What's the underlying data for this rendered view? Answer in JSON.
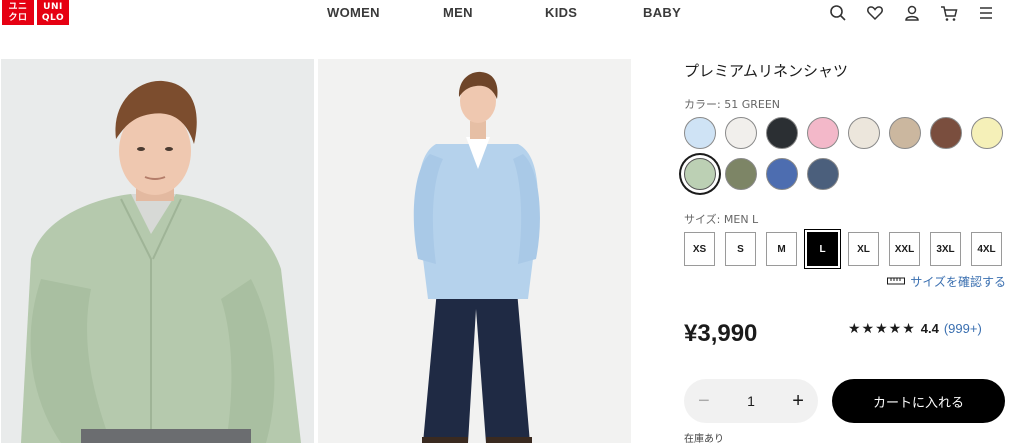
{
  "header": {
    "logo": {
      "top_text": "ユニ",
      "bottom_text": "クロ",
      "top_text2": "UNI",
      "bottom_text2": "QLO",
      "color": "#e60012"
    },
    "nav": [
      "WOMEN",
      "MEN",
      "KIDS",
      "BABY"
    ],
    "icons": [
      "search-icon",
      "heart-icon",
      "user-icon",
      "cart-icon",
      "menu-icon"
    ]
  },
  "product": {
    "title": "プレミアムリネンシャツ",
    "color_label": "カラー: 51 GREEN",
    "swatches": [
      {
        "name": "light-blue",
        "color": "#cfe3f5"
      },
      {
        "name": "off-white",
        "color": "#f1efec"
      },
      {
        "name": "charcoal",
        "color": "#2b2f33"
      },
      {
        "name": "pink",
        "color": "#f3b8c9"
      },
      {
        "name": "natural",
        "color": "#ece6dc"
      },
      {
        "name": "beige",
        "color": "#cbb79f"
      },
      {
        "name": "brown",
        "color": "#7a4e3e"
      },
      {
        "name": "yellow",
        "color": "#f5f0b8"
      },
      {
        "name": "green",
        "color": "#bcd0b4",
        "selected": true
      },
      {
        "name": "olive",
        "color": "#7d8566"
      },
      {
        "name": "blue",
        "color": "#4d6db0"
      },
      {
        "name": "navy",
        "color": "#4b5f7c"
      }
    ],
    "size_label": "サイズ: MEN L",
    "sizes": [
      "XS",
      "S",
      "M",
      "L",
      "XL",
      "XXL",
      "3XL",
      "4XL"
    ],
    "selected_size": "L",
    "size_guide": "サイズを確認する",
    "price": "¥3,990",
    "stars": "★★★★★",
    "rating": "4.4",
    "review_count": "(999+)",
    "quantity": "1",
    "qty_minus": "−",
    "qty_plus": "+",
    "cart_button": "カートに入れる",
    "stock_text": "在庫あり"
  }
}
